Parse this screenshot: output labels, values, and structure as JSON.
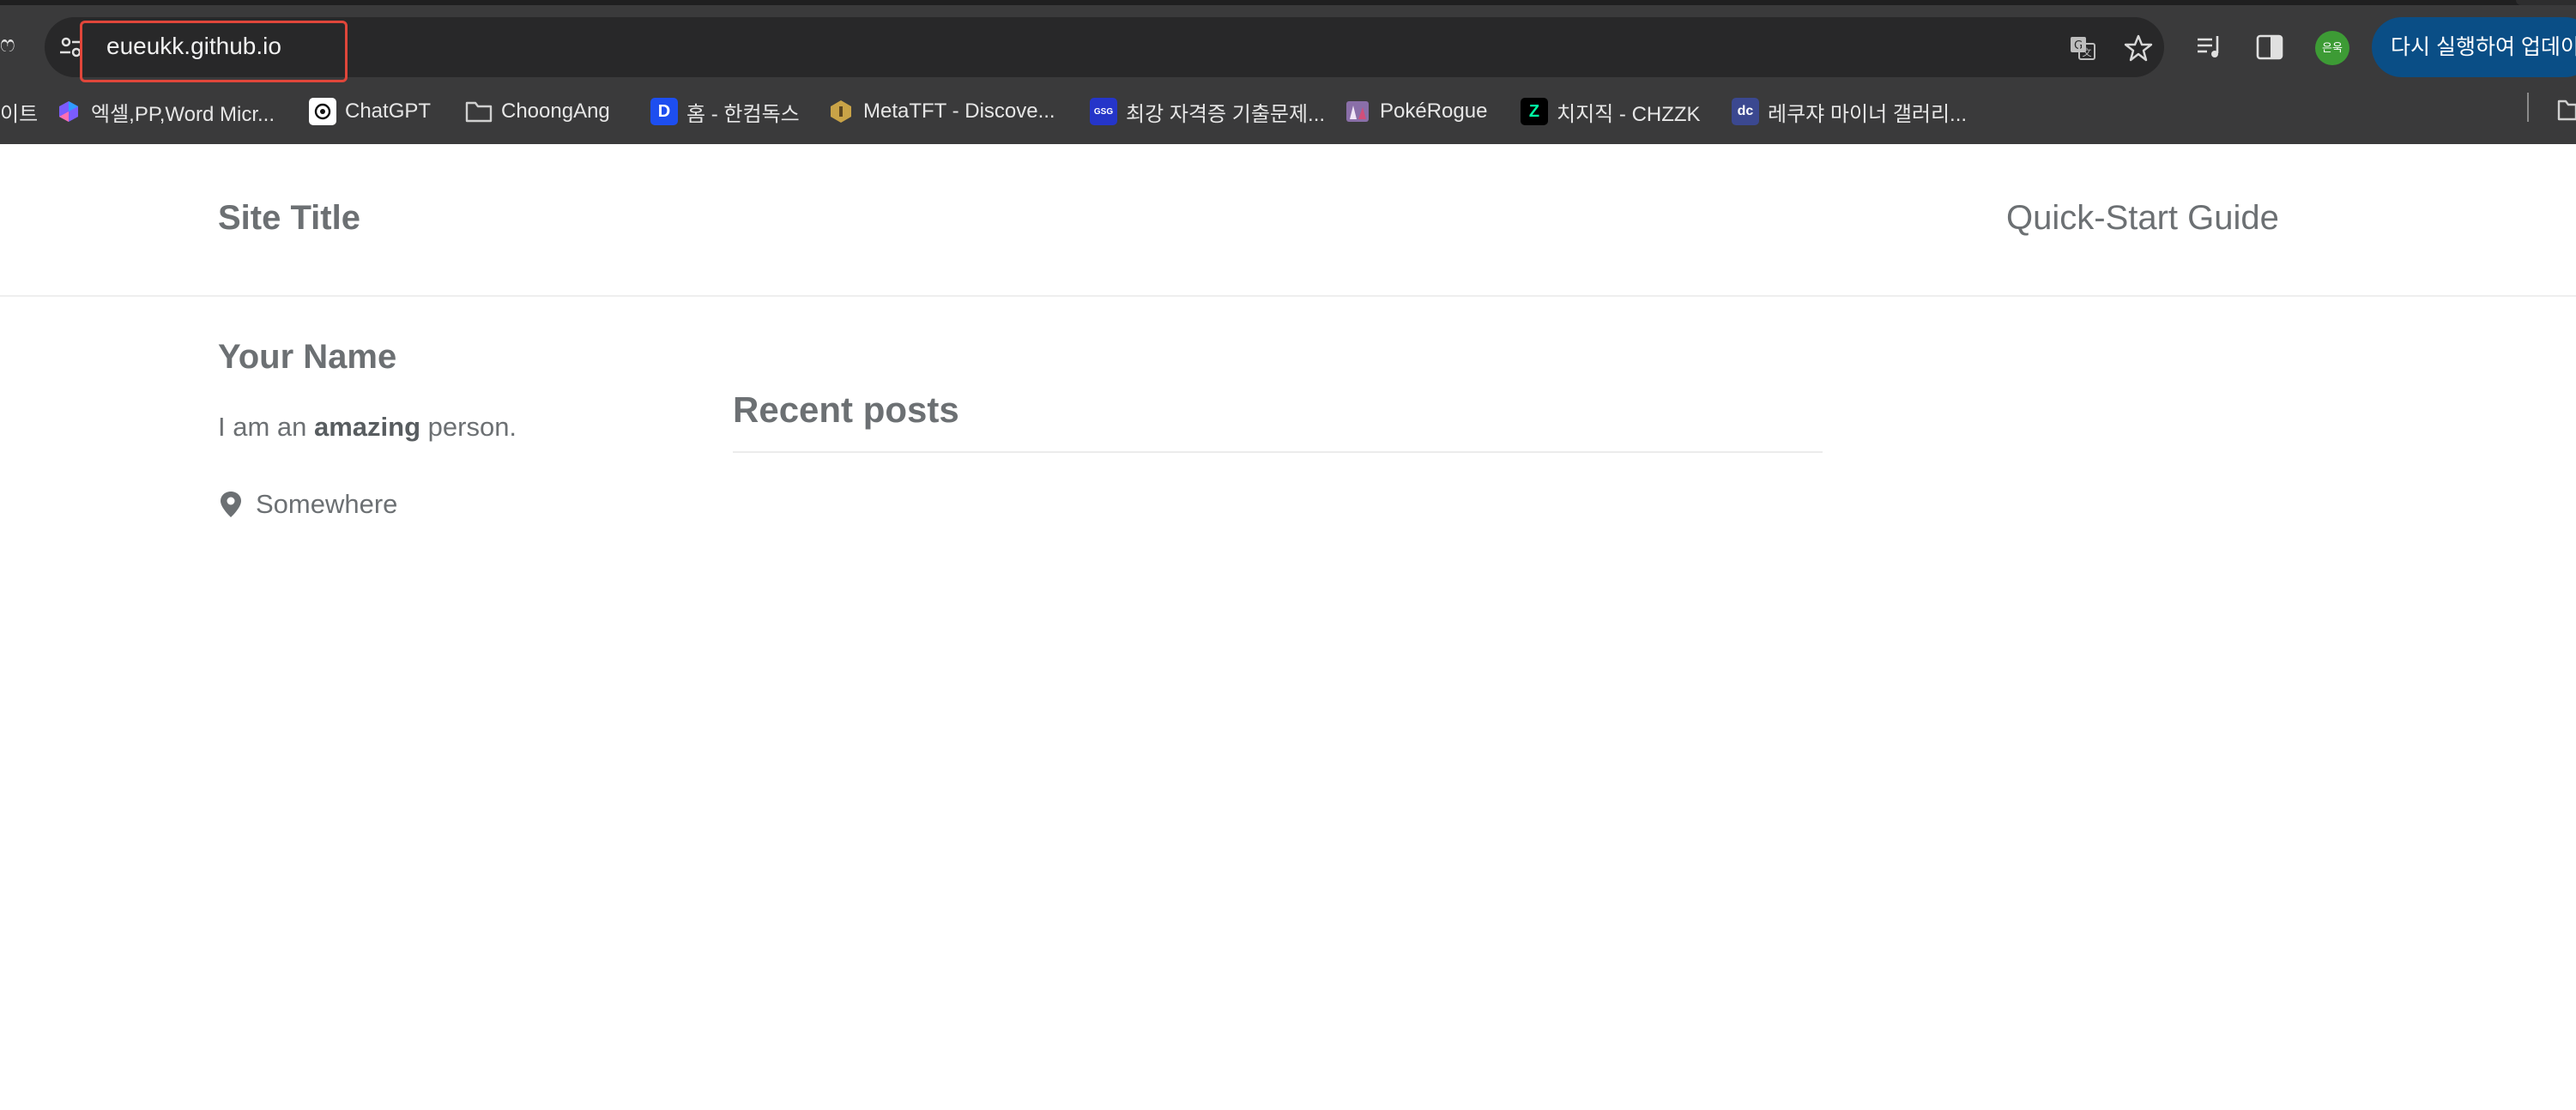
{
  "browser": {
    "nav_glyph": "ෆ",
    "url": "eueukk.github.io",
    "profile_initials": "은욱",
    "update_button_label": "다시 실행하여 업데이트",
    "icons": [
      "tune-icon",
      "translate-icon",
      "star-icon",
      "playlist-icon",
      "side-panel-icon"
    ]
  },
  "bookmarks": {
    "partial_left": "이트",
    "items": [
      {
        "label": "엑셀,PP,Word Micr...",
        "icon": "copilot-icon",
        "color": "#7a5cff"
      },
      {
        "label": "ChatGPT",
        "icon": "chatgpt-icon",
        "color": "#ffffff"
      },
      {
        "label": "ChoongAng",
        "icon": "folder-icon",
        "color": "#d0d0d0"
      },
      {
        "label": "홈 - 한컴독스",
        "icon": "hancom-docs-icon",
        "glyph": "D",
        "color": "#1d4ef0"
      },
      {
        "label": "MetaTFT - Discove...",
        "icon": "metatft-icon",
        "color": "#c9a347"
      },
      {
        "label": "최강 자격증 기출문제...",
        "icon": "exam-site-icon",
        "glyph": "GSG",
        "color": "#2535c9"
      },
      {
        "label": "PokéRogue",
        "icon": "pokerogue-icon",
        "color": "#8a6fa8"
      },
      {
        "label": "치지직 - CHZZK",
        "icon": "chzzk-icon",
        "glyph": "Z",
        "color": "#000000"
      },
      {
        "label": "레쿠쟈 마이너 갤러리...",
        "icon": "dcinside-icon",
        "glyph": "dc",
        "color": "#3b4890"
      }
    ]
  },
  "site": {
    "title": "Site Title",
    "nav_link": "Quick-Start Guide",
    "author": {
      "name": "Your Name",
      "bio_prefix": "I am an ",
      "bio_emphasis": "amazing",
      "bio_suffix": " person.",
      "location": "Somewhere"
    },
    "section_title": "Recent posts"
  }
}
